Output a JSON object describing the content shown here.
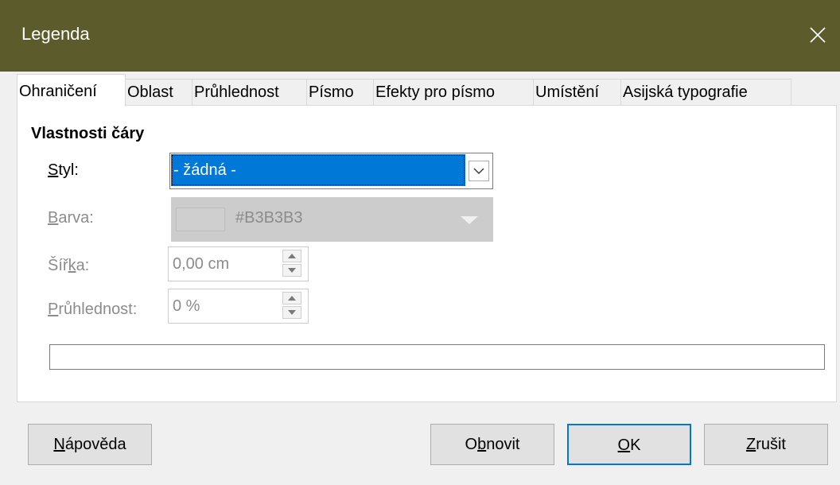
{
  "window": {
    "title": "Legenda",
    "close_icon": "close-icon"
  },
  "tabs": [
    {
      "label": "Ohraničení",
      "active": true
    },
    {
      "label": "Oblast"
    },
    {
      "label": "Průhlednost"
    },
    {
      "label": "Písmo"
    },
    {
      "label": "Efekty pro písmo"
    },
    {
      "label": "Umístění"
    },
    {
      "label": "Asijská typografie"
    }
  ],
  "line_properties": {
    "section_title": "Vlastnosti čáry",
    "style": {
      "label_pre": "",
      "label_mnemonic": "S",
      "label_post": "tyl:",
      "value": "- žádná -"
    },
    "color": {
      "label_mnemonic": "B",
      "label_post": "arva:",
      "value": "#B3B3B3",
      "swatch_color": "#cfcfcf"
    },
    "width": {
      "label_pre": "Šíř",
      "label_mnemonic": "k",
      "label_post": "a:",
      "value": "0,00 cm"
    },
    "transparency": {
      "label_mnemonic": "P",
      "label_post": "růhlednost:",
      "value": "0 %"
    }
  },
  "buttons": {
    "help": {
      "mnemonic": "N",
      "rest": "ápověda"
    },
    "reset": {
      "pre": "O",
      "mnemonic": "b",
      "rest": "novit"
    },
    "ok": {
      "mnemonic": "O",
      "rest": "K"
    },
    "cancel": {
      "mnemonic": "Z",
      "rest": "rušit"
    }
  },
  "colors": {
    "titlebar": "#5b5b2b",
    "selection": "#0078d7"
  }
}
